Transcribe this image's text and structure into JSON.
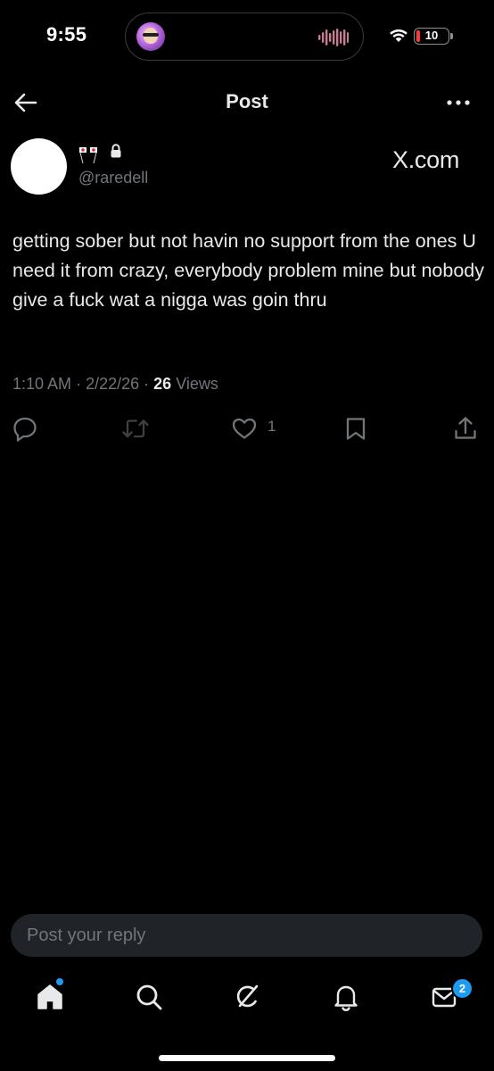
{
  "status_bar": {
    "time": "9:55",
    "battery_level": "10",
    "battery_color": "#ff3b30"
  },
  "header": {
    "title": "Post",
    "back_icon": "arrow-left-icon",
    "more_icon": "more-horizontal-icon"
  },
  "post": {
    "author_handle": "@raredell",
    "name_emoji": [
      "japan-flag",
      "japan-flag"
    ],
    "protected_icon": "lock-icon",
    "source_label": "X.com",
    "text": "getting sober but not havin no support from the ones U need it from crazy, everybody problem mine but nobody give a fuck wat a nigga was goin thru",
    "time": "1:10 AM",
    "date": "2/22/26",
    "separator": "·",
    "views_count": "26",
    "views_label": "Views",
    "likes_count": "1"
  },
  "actions": [
    {
      "name": "reply",
      "icon": "reply-icon"
    },
    {
      "name": "repost",
      "icon": "repost-icon"
    },
    {
      "name": "like",
      "icon": "heart-icon"
    },
    {
      "name": "bookmark",
      "icon": "bookmark-icon"
    },
    {
      "name": "share",
      "icon": "share-icon"
    }
  ],
  "reply_box": {
    "placeholder": "Post your reply"
  },
  "bottom_nav": {
    "items": [
      {
        "name": "home",
        "icon": "home-icon"
      },
      {
        "name": "search",
        "icon": "search-icon"
      },
      {
        "name": "grok",
        "icon": "grok-icon"
      },
      {
        "name": "notifications",
        "icon": "bell-icon"
      },
      {
        "name": "messages",
        "icon": "mail-icon"
      }
    ],
    "messages_badge": "2"
  },
  "colors": {
    "background": "#000000",
    "text_primary": "#e7e9ea",
    "text_secondary": "#71767b",
    "accent": "#1d9bf0",
    "input_bg": "#202327"
  }
}
